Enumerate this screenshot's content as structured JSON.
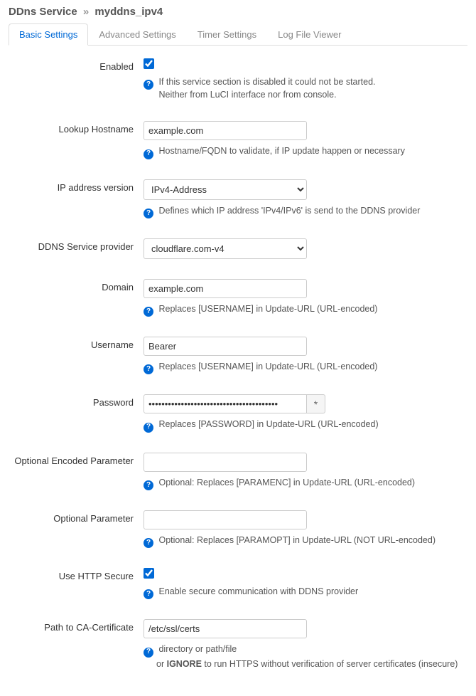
{
  "header": {
    "service": "DDns Service",
    "sep": "»",
    "name": "myddns_ipv4"
  },
  "tabs": [
    {
      "label": "Basic Settings",
      "active": true
    },
    {
      "label": "Advanced Settings",
      "active": false
    },
    {
      "label": "Timer Settings",
      "active": false
    },
    {
      "label": "Log File Viewer",
      "active": false
    }
  ],
  "pw_toggle_glyph": "*",
  "fields": {
    "enabled": {
      "label": "Enabled",
      "checked": true,
      "help": "If this service section is disabled it could not be started.\nNeither from LuCI interface nor from console."
    },
    "lookup": {
      "label": "Lookup Hostname",
      "value": "example.com",
      "help": "Hostname/FQDN to validate, if IP update happen or necessary"
    },
    "ipver": {
      "label": "IP address version",
      "value": "IPv4-Address",
      "help": "Defines which IP address 'IPv4/IPv6' is send to the DDNS provider"
    },
    "provider": {
      "label": "DDNS Service provider",
      "value": "cloudflare.com-v4"
    },
    "domain": {
      "label": "Domain",
      "value": "example.com",
      "help": "Replaces [USERNAME] in Update-URL (URL-encoded)"
    },
    "username": {
      "label": "Username",
      "value": "Bearer",
      "help": "Replaces [USERNAME] in Update-URL (URL-encoded)"
    },
    "password": {
      "label": "Password",
      "value": "••••••••••••••••••••••••••••••••••••••••",
      "help": "Replaces [PASSWORD] in Update-URL (URL-encoded)"
    },
    "paramenc": {
      "label": "Optional Encoded Parameter",
      "value": "",
      "help": "Optional: Replaces [PARAMENC] in Update-URL (URL-encoded)"
    },
    "paramopt": {
      "label": "Optional Parameter",
      "value": "",
      "help": "Optional: Replaces [PARAMOPT] in Update-URL (NOT URL-encoded)"
    },
    "https": {
      "label": "Use HTTP Secure",
      "checked": true,
      "help": "Enable secure communication with DDNS provider"
    },
    "cacert": {
      "label": "Path to CA-Certificate",
      "value": "/etc/ssl/certs",
      "help_l1": "directory or path/file",
      "help_l2a": "or ",
      "help_l2b": "IGNORE",
      "help_l2c": " to run HTTPS without verification of server certificates (insecure)"
    }
  }
}
